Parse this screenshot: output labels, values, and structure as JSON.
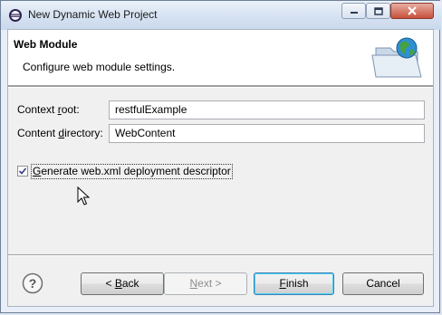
{
  "window": {
    "title": "New Dynamic Web Project",
    "controls": {
      "minimize": "minimize",
      "maximize": "maximize",
      "close": "close"
    }
  },
  "header": {
    "title": "Web Module",
    "description": "Configure web module settings.",
    "icon": "web-project-folder-globe-icon"
  },
  "form": {
    "context_root": {
      "label_pre": "Context ",
      "label_u": "r",
      "label_post": "oot:",
      "value": "restfulExample"
    },
    "content_directory": {
      "label_pre": "Content ",
      "label_u": "d",
      "label_post": "irectory:",
      "value": "WebContent"
    },
    "generate_descriptor": {
      "label_u": "G",
      "label_post": "enerate web.xml deployment descriptor",
      "checked": true
    }
  },
  "buttons": {
    "back": {
      "label_pre": "< ",
      "label_u": "B",
      "label_post": "ack"
    },
    "next": {
      "label_u": "N",
      "label_post": "ext >"
    },
    "finish": {
      "label_u": "F",
      "label_post": "inish"
    },
    "cancel": {
      "label": "Cancel"
    }
  },
  "colors": {
    "accent": "#3c7fb1",
    "title_bar": "#d6e2f1",
    "client_bg": "#f0f0f0"
  }
}
